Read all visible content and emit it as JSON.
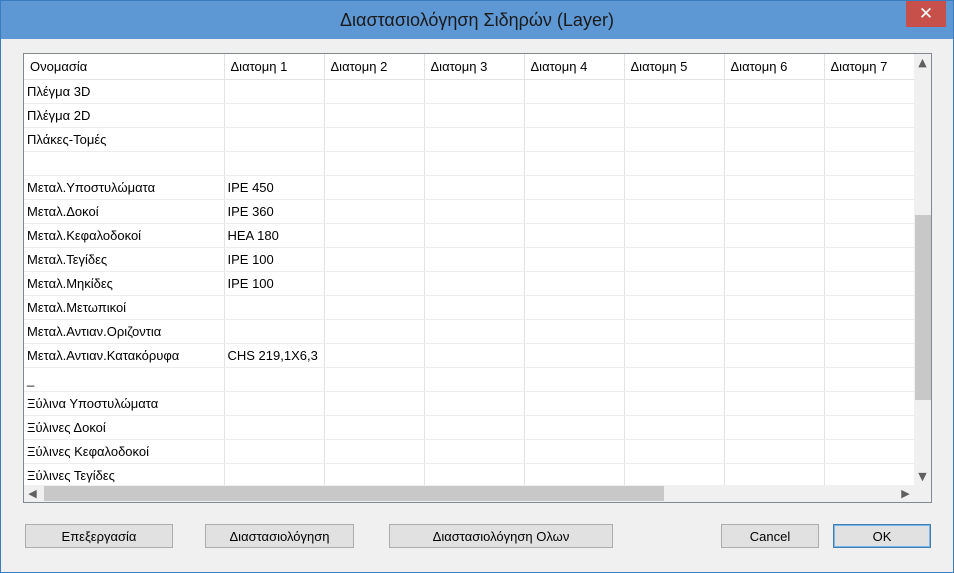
{
  "window": {
    "title": "Διαστασιολόγηση Σιδηρών (Layer)",
    "close_glyph": "✕"
  },
  "grid": {
    "columns": [
      "Ονομασία",
      "Διατομη 1",
      "Διατομη 2",
      "Διατομη 3",
      "Διατομη 4",
      "Διατομη 5",
      "Διατομη 6",
      "Διατομη 7"
    ],
    "rows": [
      [
        "Πλέγμα 3D",
        "",
        "",
        "",
        "",
        "",
        "",
        ""
      ],
      [
        "Πλέγμα 2D",
        "",
        "",
        "",
        "",
        "",
        "",
        ""
      ],
      [
        "Πλάκες-Τομές",
        "",
        "",
        "",
        "",
        "",
        "",
        ""
      ],
      [
        "",
        "",
        "",
        "",
        "",
        "",
        "",
        ""
      ],
      [
        "Μεταλ.Υποστυλώματα",
        "IPE 450",
        "",
        "",
        "",
        "",
        "",
        ""
      ],
      [
        "Μεταλ.Δοκοί",
        "IPE 360",
        "",
        "",
        "",
        "",
        "",
        ""
      ],
      [
        "Μεταλ.Κεφαλοδοκοί",
        "HEA 180",
        "",
        "",
        "",
        "",
        "",
        ""
      ],
      [
        "Μεταλ.Τεγίδες",
        "IPE 100",
        "",
        "",
        "",
        "",
        "",
        ""
      ],
      [
        "Μεταλ.Μηκίδες",
        "IPE 100",
        "",
        "",
        "",
        "",
        "",
        ""
      ],
      [
        "Μεταλ.Μετωπικοί",
        "",
        "",
        "",
        "",
        "",
        "",
        ""
      ],
      [
        "Μεταλ.Αντιαν.Οριζοντια",
        "",
        "",
        "",
        "",
        "",
        "",
        ""
      ],
      [
        "Μεταλ.Αντιαν.Κατακόρυφα",
        "CHS 219,1X6,3",
        "",
        "",
        "",
        "",
        "",
        ""
      ],
      [
        "_",
        "",
        "",
        "",
        "",
        "",
        "",
        ""
      ],
      [
        "Ξύλινα Υποστυλώματα",
        "",
        "",
        "",
        "",
        "",
        "",
        ""
      ],
      [
        "Ξύλινες Δοκοί",
        "",
        "",
        "",
        "",
        "",
        "",
        ""
      ],
      [
        "Ξύλινες Κεφαλοδοκοί",
        "",
        "",
        "",
        "",
        "",
        "",
        ""
      ],
      [
        "Ξύλινες Τεγίδες",
        "",
        "",
        "",
        "",
        "",
        "",
        ""
      ]
    ]
  },
  "buttons": {
    "edit": "Επεξεργασία",
    "dimension": "Διαστασιολόγηση",
    "dimension_all": "Διαστασιολόγηση Ολων",
    "cancel": "Cancel",
    "ok": "OK"
  },
  "scrollbars": {
    "up": "▲",
    "down": "▼",
    "left": "◀",
    "right": "▶"
  }
}
